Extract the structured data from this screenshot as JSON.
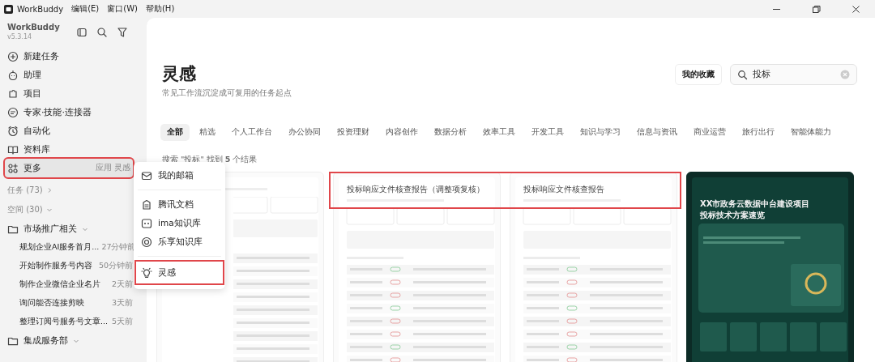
{
  "menubar": {
    "app": "WorkBuddy",
    "menus": [
      "编辑(E)",
      "窗口(W)",
      "帮助(H)"
    ]
  },
  "sidebar": {
    "app_name": "WorkBuddy",
    "version": "v5.3.14",
    "nav": [
      {
        "label": "新建任务",
        "selected": false,
        "highlighted": false
      },
      {
        "label": "助理",
        "selected": false,
        "highlighted": false
      },
      {
        "label": "项目",
        "selected": false,
        "highlighted": false
      },
      {
        "label": "专家·技能·连接器",
        "selected": false,
        "highlighted": false
      },
      {
        "label": "自动化",
        "selected": false,
        "highlighted": false
      },
      {
        "label": "资料库",
        "selected": false,
        "highlighted": false
      },
      {
        "label": "更多",
        "hint": "应用 灵感",
        "selected": true,
        "highlighted": true
      }
    ],
    "tasks_header": "任务 (73)",
    "spaces_header": "空间 (30)",
    "folders": [
      {
        "name": "市场推广相关",
        "expanded": true,
        "children": [
          {
            "title": "规划企业AI服务首月...",
            "time": "27分钟前"
          },
          {
            "title": "开始制作服务号内容",
            "time": "50分钟前"
          },
          {
            "title": "制作企业微信企业名片",
            "time": "2天前"
          },
          {
            "title": "询问能否连接剪映",
            "time": "3天前"
          },
          {
            "title": "整理订阅号服务号文章...",
            "time": "5天前"
          }
        ]
      },
      {
        "name": "集成服务部",
        "expanded": true
      }
    ]
  },
  "popup_menu": {
    "groups": [
      [
        {
          "label": "我的邮箱",
          "highlighted": false
        }
      ],
      [
        {
          "label": "腾讯文档",
          "highlighted": false
        },
        {
          "label": "ima知识库",
          "highlighted": false
        },
        {
          "label": "乐享知识库",
          "highlighted": false
        }
      ],
      [
        {
          "label": "灵感",
          "highlighted": true
        }
      ]
    ]
  },
  "main": {
    "title": "灵感",
    "subtitle": "常见工作流沉淀成可复用的任务起点",
    "favorites_button": "我的收藏",
    "search": {
      "value": "投标"
    },
    "tabs": [
      {
        "label": "全部",
        "selected": true
      },
      {
        "label": "精选",
        "selected": false
      },
      {
        "label": "个人工作台",
        "selected": false
      },
      {
        "label": "办公协同",
        "selected": false
      },
      {
        "label": "投资理财",
        "selected": false
      },
      {
        "label": "内容创作",
        "selected": false
      },
      {
        "label": "数据分析",
        "selected": false
      },
      {
        "label": "效率工具",
        "selected": false
      },
      {
        "label": "开发工具",
        "selected": false
      },
      {
        "label": "知识与学习",
        "selected": false
      },
      {
        "label": "信息与资讯",
        "selected": false
      },
      {
        "label": "商业运营",
        "selected": false
      },
      {
        "label": "旅行出行",
        "selected": false
      },
      {
        "label": "智能体能力",
        "selected": false
      }
    ],
    "result_text": "搜索 \"投标\" 找到 **5** 个结果",
    "cards": [
      {
        "kind": "light",
        "highlighted": false
      },
      {
        "kind": "light",
        "title": "投标响应文件核查报告（调整项复核）",
        "highlighted": true
      },
      {
        "kind": "light",
        "title": "投标响应文件核查报告",
        "highlighted": true
      },
      {
        "kind": "dark",
        "title": "XX市政务云数据中台建设项目",
        "subtitle": "投标技术方案速览",
        "highlighted": false
      }
    ]
  }
}
